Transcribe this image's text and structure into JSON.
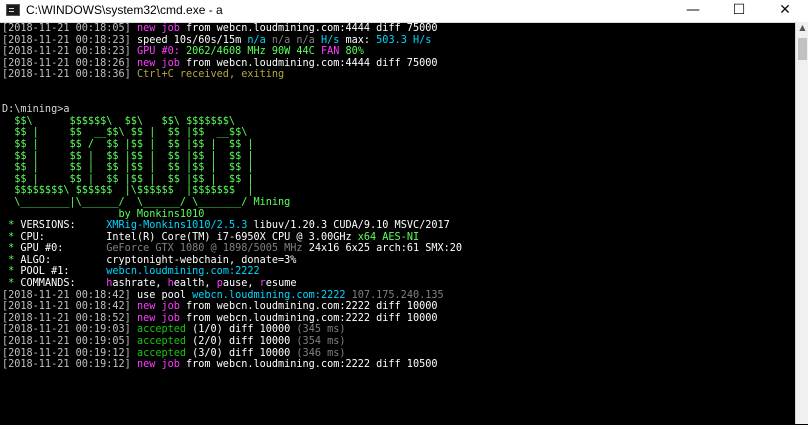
{
  "titlebar": {
    "title": "C:\\WINDOWS\\system32\\cmd.exe - a",
    "minimize": "—",
    "maximize": "☐",
    "close": "✕"
  },
  "scrollbar": {
    "up": "▲"
  },
  "colors": {
    "default": "#c0c0c0",
    "white": "#ffffff",
    "magenta": "#ff3cff",
    "cyan": "#00d7ff",
    "gray": "#808080",
    "green": "#16c60c",
    "lime": "#5cff5c",
    "olive": "#b5a642",
    "yellow": "#ffff55",
    "prompt": "#d6d6d6"
  },
  "console": {
    "lines": [
      [
        {
          "t": "[2018-11-21 00:18:05] ",
          "c": "default"
        },
        {
          "t": "new job",
          "c": "magenta"
        },
        {
          "t": " from webcn.loudmining.com:4444 diff 75000",
          "c": "white"
        }
      ],
      [
        {
          "t": "[2018-11-21 00:18:23] ",
          "c": "default"
        },
        {
          "t": "speed 10s/60s/15m ",
          "c": "white"
        },
        {
          "t": "n/a",
          "c": "cyan"
        },
        {
          "t": " n/a n/a ",
          "c": "gray"
        },
        {
          "t": "H/s",
          "c": "cyan"
        },
        {
          "t": " max: ",
          "c": "white"
        },
        {
          "t": "503.3 H/s",
          "c": "cyan"
        }
      ],
      [
        {
          "t": "[2018-11-21 00:18:23] ",
          "c": "default"
        },
        {
          "t": "GPU #0: ",
          "c": "magenta"
        },
        {
          "t": "2062/4608 MHz 90W 44C",
          "c": "lime"
        },
        {
          "t": " FAN ",
          "c": "magenta"
        },
        {
          "t": "80%",
          "c": "lime"
        }
      ],
      [
        {
          "t": "[2018-11-21 00:18:26] ",
          "c": "default"
        },
        {
          "t": "new job",
          "c": "magenta"
        },
        {
          "t": " from webcn.loudmining.com:4444 diff 75000",
          "c": "white"
        }
      ],
      [
        {
          "t": "[2018-11-21 00:18:36] ",
          "c": "default"
        },
        {
          "t": "Ctrl+C received, exiting",
          "c": "olive"
        }
      ],
      [
        {
          "t": "",
          "c": "default"
        }
      ],
      [
        {
          "t": "",
          "c": "default"
        }
      ],
      [
        {
          "t": "D:\\mining>a",
          "c": "prompt"
        }
      ],
      [
        {
          "t": "  $$\\      $$$$$$\\  $$\\   $$\\ $$$$$$$\\",
          "c": "lime"
        }
      ],
      [
        {
          "t": "  $$ |     $$  __$$\\ $$ |  $$ |$$  __$$\\",
          "c": "lime"
        }
      ],
      [
        {
          "t": "  $$ |     $$ /  $$ |$$ |  $$ |$$ |  $$ |",
          "c": "lime"
        }
      ],
      [
        {
          "t": "  $$ |     $$ |  $$ |$$ |  $$ |$$ |  $$ |",
          "c": "lime"
        }
      ],
      [
        {
          "t": "  $$ |     $$ |  $$ |$$ |  $$ |$$ |  $$ |",
          "c": "lime"
        }
      ],
      [
        {
          "t": "  $$ |     $$ |  $$ |$$ |  $$ |$$ |  $$ |",
          "c": "lime"
        }
      ],
      [
        {
          "t": "  $$$$$$$$\\ $$$$$$  |\\$$$$$$  |$$$$$$$  |",
          "c": "lime"
        }
      ],
      [
        {
          "t": "  \\________|\\______/  \\______/ \\_______/ Mining",
          "c": "lime"
        }
      ],
      [
        {
          "t": "                   by Monkins1010",
          "c": "lime"
        }
      ],
      [
        {
          "t": " * ",
          "c": "lime"
        },
        {
          "t": "VERSIONS:     ",
          "c": "white"
        },
        {
          "t": "XMRig-Monkins1010/2.5.3",
          "c": "cyan"
        },
        {
          "t": " libuv/1.20.3 CUDA/9.10 MSVC/2017",
          "c": "white"
        }
      ],
      [
        {
          "t": " * ",
          "c": "lime"
        },
        {
          "t": "CPU:          Intel(R) Core(TM) i7-6950X CPU @ 3.00GHz ",
          "c": "white"
        },
        {
          "t": "x64 AES-NI",
          "c": "lime"
        }
      ],
      [
        {
          "t": " * ",
          "c": "lime"
        },
        {
          "t": "GPU #0:       ",
          "c": "white"
        },
        {
          "t": "GeForce GTX 1080 @ 1898/5005 MHz",
          "c": "gray"
        },
        {
          "t": " 24x16 6x25 arch:61 SMX:20",
          "c": "white"
        }
      ],
      [
        {
          "t": " * ",
          "c": "lime"
        },
        {
          "t": "ALGO:         cryptonight-webchain, donate=3%",
          "c": "white"
        }
      ],
      [
        {
          "t": " * ",
          "c": "lime"
        },
        {
          "t": "POOL #1:      ",
          "c": "white"
        },
        {
          "t": "webcn.loudmining.com:2222",
          "c": "cyan"
        }
      ],
      [
        {
          "t": " * ",
          "c": "lime"
        },
        {
          "t": "COMMANDS:     ",
          "c": "white"
        },
        {
          "t": "h",
          "c": "magenta"
        },
        {
          "t": "ashrate, ",
          "c": "white"
        },
        {
          "t": "h",
          "c": "magenta"
        },
        {
          "t": "ealth, ",
          "c": "white"
        },
        {
          "t": "p",
          "c": "magenta"
        },
        {
          "t": "ause, ",
          "c": "white"
        },
        {
          "t": "r",
          "c": "magenta"
        },
        {
          "t": "esume",
          "c": "white"
        }
      ],
      [
        {
          "t": "[2018-11-21 00:18:42] ",
          "c": "default"
        },
        {
          "t": "use pool ",
          "c": "white"
        },
        {
          "t": "webcn.loudmining.com:2222",
          "c": "cyan"
        },
        {
          "t": " 107.175.240.135",
          "c": "gray"
        }
      ],
      [
        {
          "t": "[2018-11-21 00:18:42] ",
          "c": "default"
        },
        {
          "t": "new job",
          "c": "magenta"
        },
        {
          "t": " from webcn.loudmining.com:2222 diff 10000",
          "c": "white"
        }
      ],
      [
        {
          "t": "[2018-11-21 00:18:52] ",
          "c": "default"
        },
        {
          "t": "new job",
          "c": "magenta"
        },
        {
          "t": " from webcn.loudmining.com:2222 diff 10000",
          "c": "white"
        }
      ],
      [
        {
          "t": "[2018-11-21 00:19:03] ",
          "c": "default"
        },
        {
          "t": "accepted",
          "c": "green"
        },
        {
          "t": " (1/0) diff 10000 ",
          "c": "white"
        },
        {
          "t": "(345 ms)",
          "c": "gray"
        }
      ],
      [
        {
          "t": "[2018-11-21 00:19:05] ",
          "c": "default"
        },
        {
          "t": "accepted",
          "c": "green"
        },
        {
          "t": " (2/0) diff 10000 ",
          "c": "white"
        },
        {
          "t": "(354 ms)",
          "c": "gray"
        }
      ],
      [
        {
          "t": "[2018-11-21 00:19:12] ",
          "c": "default"
        },
        {
          "t": "accepted",
          "c": "green"
        },
        {
          "t": " (3/0) diff 10000 ",
          "c": "white"
        },
        {
          "t": "(346 ms)",
          "c": "gray"
        }
      ],
      [
        {
          "t": "[2018-11-21 00:19:12] ",
          "c": "default"
        },
        {
          "t": "new job",
          "c": "magenta"
        },
        {
          "t": " from webcn.loudmining.com:2222 diff 10500",
          "c": "white"
        }
      ]
    ]
  }
}
